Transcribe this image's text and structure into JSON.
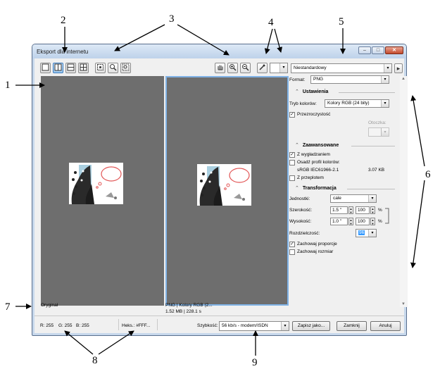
{
  "callouts": [
    "1",
    "2",
    "3",
    "4",
    "5",
    "6",
    "7",
    "8",
    "9"
  ],
  "window": {
    "title": "Eksport dla internetu",
    "minimize": "–",
    "maximize": "□",
    "close": "✕"
  },
  "toolbar": {
    "view_icons": [
      "single-view-icon",
      "split-vertical-icon",
      "split-horizontal-icon",
      "quad-view-icon"
    ],
    "fit_icons": [
      "fit-to-window-icon",
      "zoom-to-100-icon",
      "zoom-to-fit-selection-icon"
    ],
    "hand_icon": "hand-icon",
    "zoom_in_icon": "zoom-in-icon",
    "zoom_out_icon": "zoom-out-icon",
    "eyedropper_icon": "eyedropper-icon",
    "preset": "Niestandardowy",
    "next_icon": "chevron-right-icon"
  },
  "panel": {
    "format_label": "Format:",
    "format_value": "PNG",
    "settings_section": "Ustawienia",
    "color_mode_label": "Tryb kolorów:",
    "color_mode_value": "Kolory RGB (24 bity)",
    "transparency_label": "Przezroczystość",
    "matte_label": "Otoczka:",
    "advanced_section": "Zaawansowane",
    "antialias_label": "Z wygładzaniem",
    "embed_profile_label": "Osadź profil kolorów:",
    "profile_name": "sRGB IEC61966-2.1",
    "profile_size": "3.07 KB",
    "interlace_label": "Z przeplotem",
    "transform_section": "Transformacja",
    "units_label": "Jednostki:",
    "units_value": "cale",
    "width_label": "Szerokość:",
    "width_value": "1.5 \"",
    "width_pct": "100",
    "height_label": "Wysokość:",
    "height_value": "1.0 \"",
    "height_pct": "100",
    "percent": "%",
    "resolution_label": "Rozdzielczość:",
    "resolution_value": "96",
    "keep_ratio_label": "Zachowaj proporcje",
    "keep_size_label": "Zachowaj rozmiar"
  },
  "info": {
    "left_label": "Oryginał",
    "right_line1": "PNG | Kolory RGB (2...",
    "right_line2": "1.52 MB | 228.1 s"
  },
  "statusbar": {
    "r": "R: 255",
    "g": "G: 255",
    "b": "B: 255",
    "hex": "Heks.: #FFF...",
    "speed_label": "Szybkość:",
    "speed_value": "56 kb/s - modem/ISDN",
    "save_as": "Zapisz jako...",
    "close": "Zamknij",
    "cancel": "Anuluj"
  }
}
